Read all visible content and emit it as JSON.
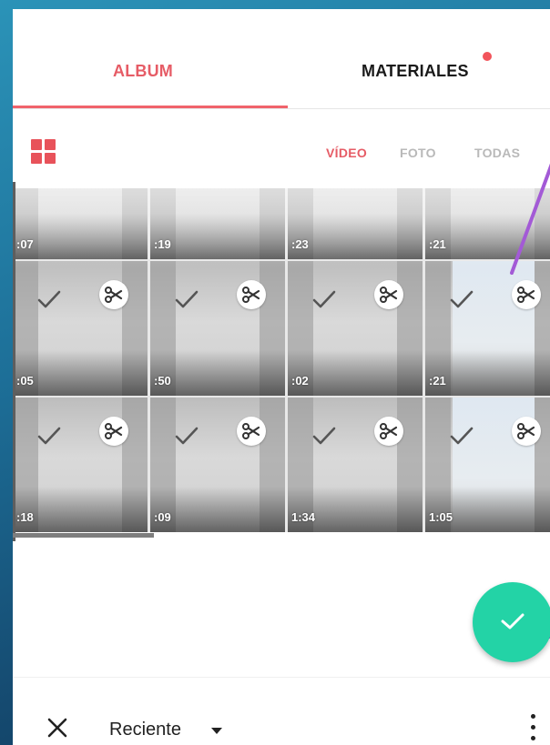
{
  "tabs": {
    "album": "ALBUM",
    "materiales": "MATERIALES"
  },
  "filters": {
    "video": "VÍDEO",
    "foto": "FOTO",
    "todas": "TODAS"
  },
  "grid": {
    "durations": [
      ":07",
      ":19",
      ":23",
      ":21",
      ":05",
      ":50",
      ":02",
      ":21",
      ":18",
      ":09",
      "1:34",
      "1:05"
    ]
  },
  "bottom_bar": {
    "sort_label": "Reciente"
  },
  "icons": {
    "grid_view": "grid-icon",
    "select": "check-icon",
    "trim": "scissors-icon",
    "confirm": "check-icon",
    "close": "close-icon",
    "sort_menu": "caret-down-icon",
    "more": "more-vertical-icon"
  },
  "colors": {
    "accent": "#e65c66",
    "fab": "#23d3a6",
    "annotation": "#a35ad6",
    "badge": "#f2545b"
  }
}
